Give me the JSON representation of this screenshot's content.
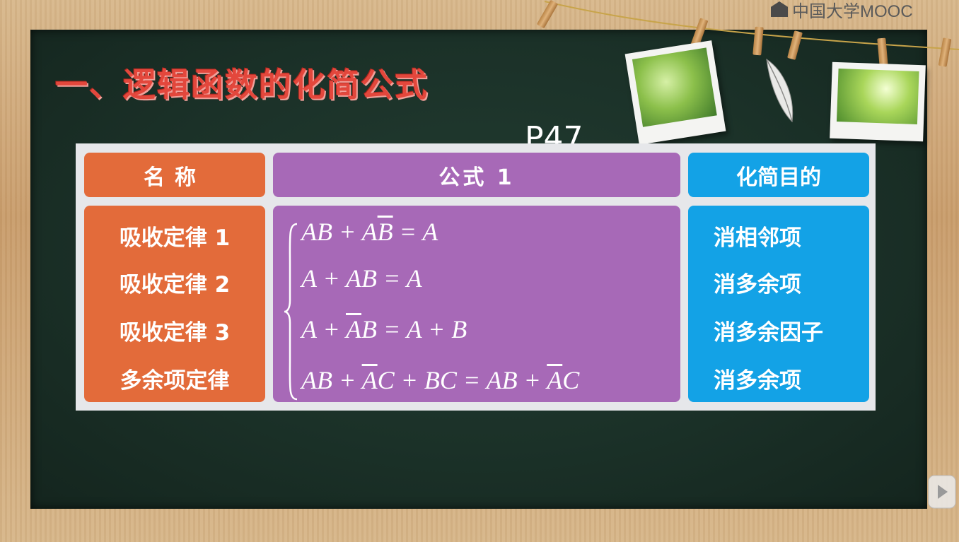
{
  "watermark": "中国大学MOOC",
  "title": "一、逻辑函数的化简公式",
  "handwritten_note": "P47",
  "table": {
    "headers": {
      "name": "名称",
      "formula": "公式 1",
      "purpose": "化简目的"
    },
    "rows": [
      {
        "name": "吸收定律 1",
        "formula_parts": [
          "AB + A",
          "B",
          " = A"
        ],
        "purpose": "消相邻项"
      },
      {
        "name": "吸收定律 2",
        "formula_parts": [
          "A + AB = A"
        ],
        "purpose": "消多余项"
      },
      {
        "name": "吸收定律 3",
        "formula_parts": [
          "A + ",
          "A",
          "B = A + B"
        ],
        "purpose": "消多余因子"
      },
      {
        "name": "多余项定律",
        "formula_parts": [
          "AB + ",
          "A",
          "C + BC = AB + ",
          "A",
          "C"
        ],
        "purpose": "消多余项"
      }
    ]
  },
  "icons": {
    "play": "play-icon",
    "mooc_logo": "mooc-logo-icon"
  },
  "colors": {
    "board": "#1b3128",
    "title": "#e3473c",
    "name_column": "#e36b3a",
    "formula_column": "#a769b7",
    "purpose_column": "#13a2e6"
  }
}
